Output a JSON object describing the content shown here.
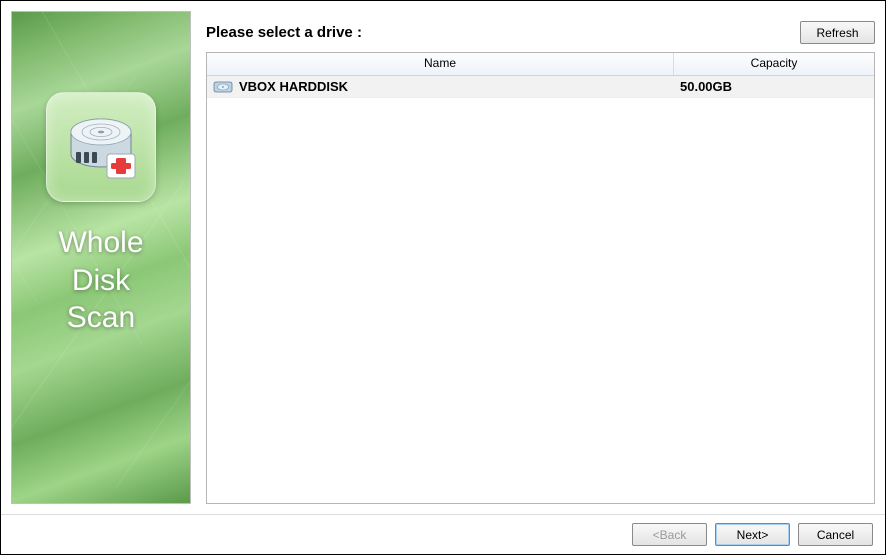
{
  "sidebar": {
    "title": "Whole\nDisk\nScan"
  },
  "header": {
    "prompt": "Please select a drive :",
    "refresh_label": "Refresh"
  },
  "table": {
    "columns": {
      "name": "Name",
      "capacity": "Capacity"
    },
    "rows": [
      {
        "name": "VBOX HARDDISK",
        "capacity": "50.00GB"
      }
    ]
  },
  "footer": {
    "back_label": "<Back",
    "next_label": "Next>",
    "cancel_label": "Cancel"
  }
}
